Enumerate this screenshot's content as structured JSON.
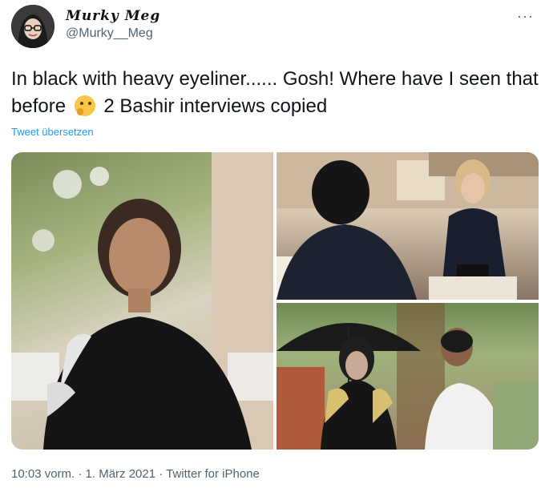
{
  "author": {
    "display_name": "Murky Meg",
    "handle": "@Murky__Meg"
  },
  "tweet": {
    "text_before_emoji": "In black with heavy eyeliner...... Gosh! Where have I seen that before",
    "emoji": "thinking-face-emoji",
    "text_after_emoji": "2 Bashir interviews copied",
    "translate_link": "Tweet übersetzen"
  },
  "media": [
    {
      "name": "photo-woman-black-dress"
    },
    {
      "name": "photo-interview-seated"
    },
    {
      "name": "photo-umbrella-interview"
    }
  ],
  "footer": {
    "meta": "10:03 vorm. · 1. März 2021 · Twitter for iPhone"
  },
  "colors": {
    "link": "#1d9bf0",
    "secondary_text": "#536471",
    "primary_text": "#0f1419"
  }
}
